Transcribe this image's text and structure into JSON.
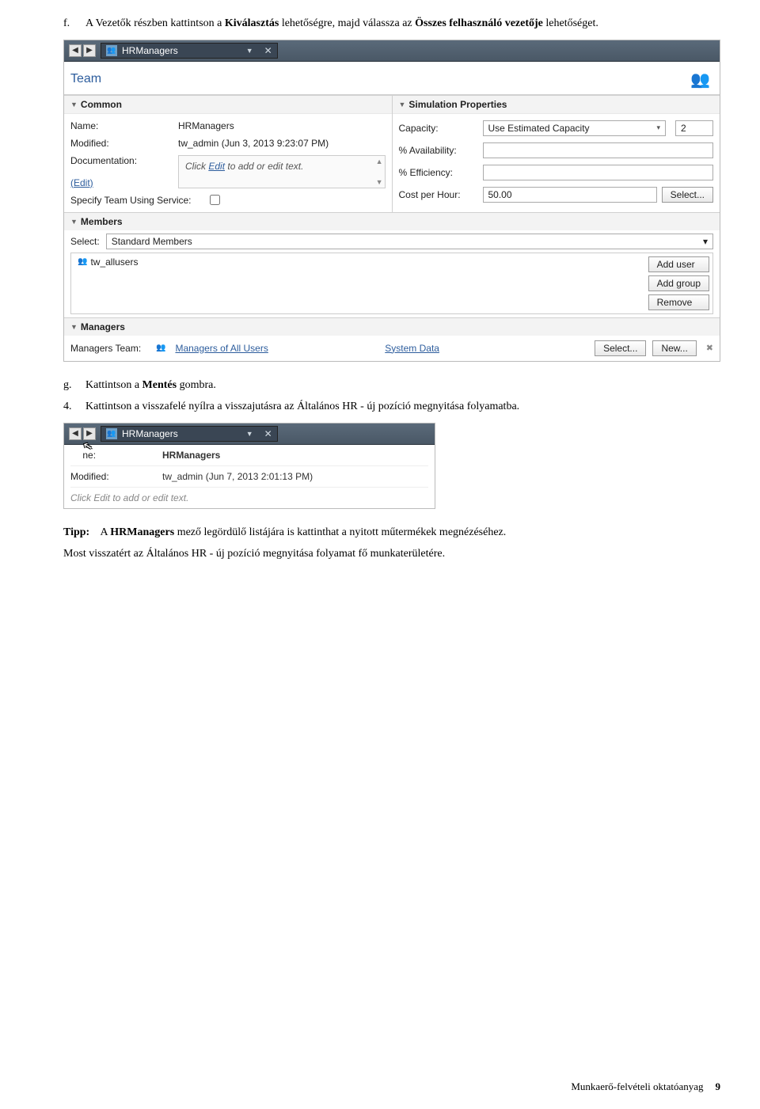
{
  "step_f": {
    "marker": "f.",
    "text_before": "A Vezetők részben kattintson a ",
    "bold1": "Kiválasztás",
    "text_mid": " lehetőségre, majd válassza az ",
    "bold2": "Összes felhasználó vezetője",
    "text_after": " lehetőséget."
  },
  "shot1": {
    "tab_title": "HRManagers",
    "team_title": "Team",
    "common_head": "Common",
    "sim_head": "Simulation Properties",
    "name_label": "Name:",
    "name_value": "HRManagers",
    "modified_label": "Modified:",
    "modified_value": "tw_admin (Jun 3, 2013 9:23:07 PM)",
    "doc_label": "Documentation:",
    "doc_hint_pre": "Click ",
    "doc_hint_link": "Edit",
    "doc_hint_post": " to add or edit text.",
    "edit_link": "(Edit)",
    "spec_label": "Specify Team Using Service:",
    "cap_label": "Capacity:",
    "cap_value": "Use Estimated Capacity",
    "cap_num": "2",
    "avail_label": "% Availability:",
    "eff_label": "% Efficiency:",
    "cost_label": "Cost per Hour:",
    "cost_value": "50.00",
    "select_btn": "Select...",
    "members_head": "Members",
    "members_select_label": "Select:",
    "members_select_value": "Standard Members",
    "member_item": "tw_allusers",
    "add_user_btn": "Add user",
    "add_group_btn": "Add group",
    "remove_btn": "Remove",
    "managers_head": "Managers",
    "managers_team_label": "Managers Team:",
    "managers_team_value": "Managers of All Users",
    "system_data": "System Data",
    "new_btn": "New..."
  },
  "step_g": {
    "marker": "g.",
    "pre": "Kattintson a ",
    "bold": "Mentés",
    "post": " gombra."
  },
  "step_4": {
    "marker": "4.",
    "text": "Kattintson a visszafelé nyílra a visszajutásra az Általános HR - új pozíció megnyitása folyamatba."
  },
  "shot2": {
    "tab_title": "HRManagers",
    "name_label_partial": "ne:",
    "name_value": "HRManagers",
    "modified_label": "Modified:",
    "modified_value": "tw_admin (Jun 7, 2013 2:01:13 PM)",
    "doc_hint": "Click Edit to add or edit text."
  },
  "tip": {
    "pre": "Tipp:",
    "s1_a": "A ",
    "s1_b": "HRManagers",
    "s1_c": " mező legördülő listájára is kattinthat a nyitott műtermékek megnézéséhez.",
    "s2": "Most visszatért az Általános HR - új pozíció megnyitása folyamat fő munkaterületére."
  },
  "footer": {
    "text": "Munkaerő-felvételi oktatóanyag",
    "page": "9"
  }
}
